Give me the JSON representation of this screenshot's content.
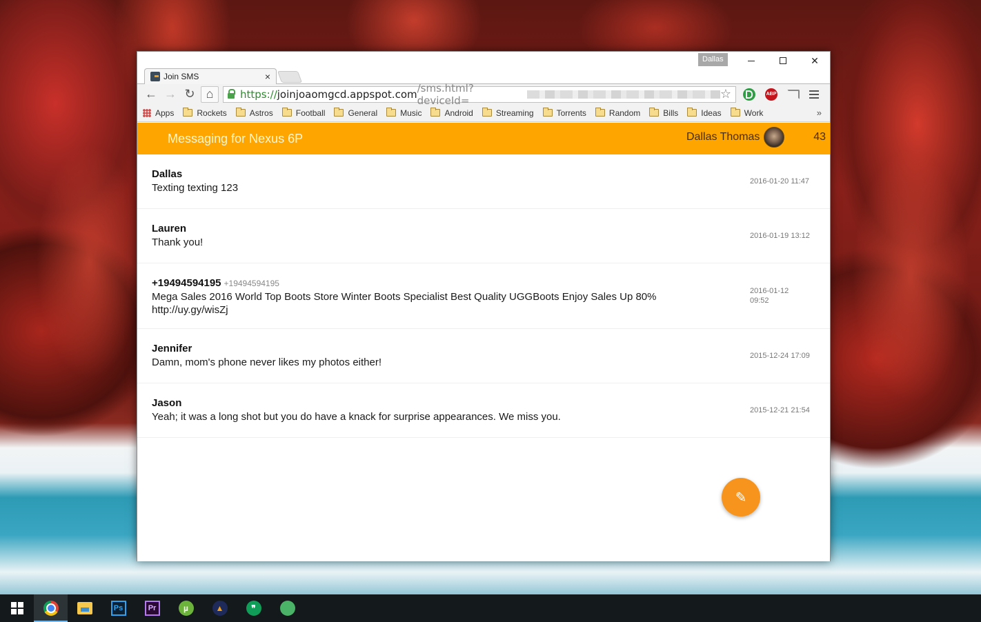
{
  "browser": {
    "profile_name": "Dallas",
    "tab": {
      "title": "Join SMS",
      "close": "×"
    },
    "address": {
      "scheme": "https://",
      "host": "joinjoaomgcd.appspot.com",
      "path": "/sms.html?deviceId="
    },
    "bookmarks": [
      {
        "label": "Apps",
        "icon": "apps-grid-icon"
      },
      {
        "label": "Rockets",
        "icon": "folder-icon"
      },
      {
        "label": "Astros",
        "icon": "folder-icon"
      },
      {
        "label": "Football",
        "icon": "folder-icon"
      },
      {
        "label": "General",
        "icon": "folder-icon"
      },
      {
        "label": "Music",
        "icon": "folder-icon"
      },
      {
        "label": "Android",
        "icon": "folder-icon"
      },
      {
        "label": "Streaming",
        "icon": "folder-icon"
      },
      {
        "label": "Torrents",
        "icon": "folder-icon"
      },
      {
        "label": "Random",
        "icon": "folder-icon"
      },
      {
        "label": "Bills",
        "icon": "folder-icon"
      },
      {
        "label": "Ideas",
        "icon": "folder-icon"
      },
      {
        "label": "Work",
        "icon": "folder-icon"
      }
    ],
    "bookmarks_overflow": "»",
    "extensions": [
      {
        "name": "pushbullet-icon",
        "label": ""
      },
      {
        "name": "adblock-plus-icon",
        "label": "ABP"
      }
    ],
    "glyphs": {
      "back": "←",
      "forward": "→",
      "reload": "↻",
      "home": "⌂",
      "star": "☆",
      "minimize": "",
      "close": "✕"
    }
  },
  "app": {
    "title": "Messaging for Nexus 6P",
    "user_name": "Dallas Thomas",
    "count": "43",
    "accent_color": "#ffa500",
    "fab_icon": "✎",
    "messages": [
      {
        "sender": "Dallas",
        "sender_sub": "",
        "body": "Texting texting 123",
        "time": "2016-01-20 11:47"
      },
      {
        "sender": "Lauren",
        "sender_sub": "",
        "body": "Thank you!",
        "time": "2016-01-19 13:12"
      },
      {
        "sender": "+19494594195",
        "sender_sub": "+19494594195",
        "body": "Mega Sales 2016 World Top Boots Store Winter Boots Specialist Best Quality UGGBoots Enjoy Sales Up 80% http://uy.gy/wisZj",
        "time": "2016-01-12 09:52"
      },
      {
        "sender": "Jennifer",
        "sender_sub": "",
        "body": "Damn, mom's phone never likes my photos either!",
        "time": "2015-12-24 17:09"
      },
      {
        "sender": "Jason",
        "sender_sub": "",
        "body": "Yeah; it was a long shot but you do have a knack for surprise appearances. We miss you.",
        "time": "2015-12-21 21:54"
      }
    ]
  },
  "taskbar": {
    "items": [
      {
        "name": "start-button",
        "label": ""
      },
      {
        "name": "chrome-taskbar-icon",
        "label": ""
      },
      {
        "name": "file-explorer-taskbar-icon",
        "label": ""
      },
      {
        "name": "photoshop-taskbar-icon",
        "label": "Ps"
      },
      {
        "name": "premiere-taskbar-icon",
        "label": "Pr"
      },
      {
        "name": "utorrent-taskbar-icon",
        "label": "µ"
      },
      {
        "name": "vpn-taskbar-icon",
        "label": "▲"
      },
      {
        "name": "hangouts-taskbar-icon",
        "label": "❞"
      },
      {
        "name": "pushbullet-taskbar-icon",
        "label": ""
      }
    ]
  }
}
